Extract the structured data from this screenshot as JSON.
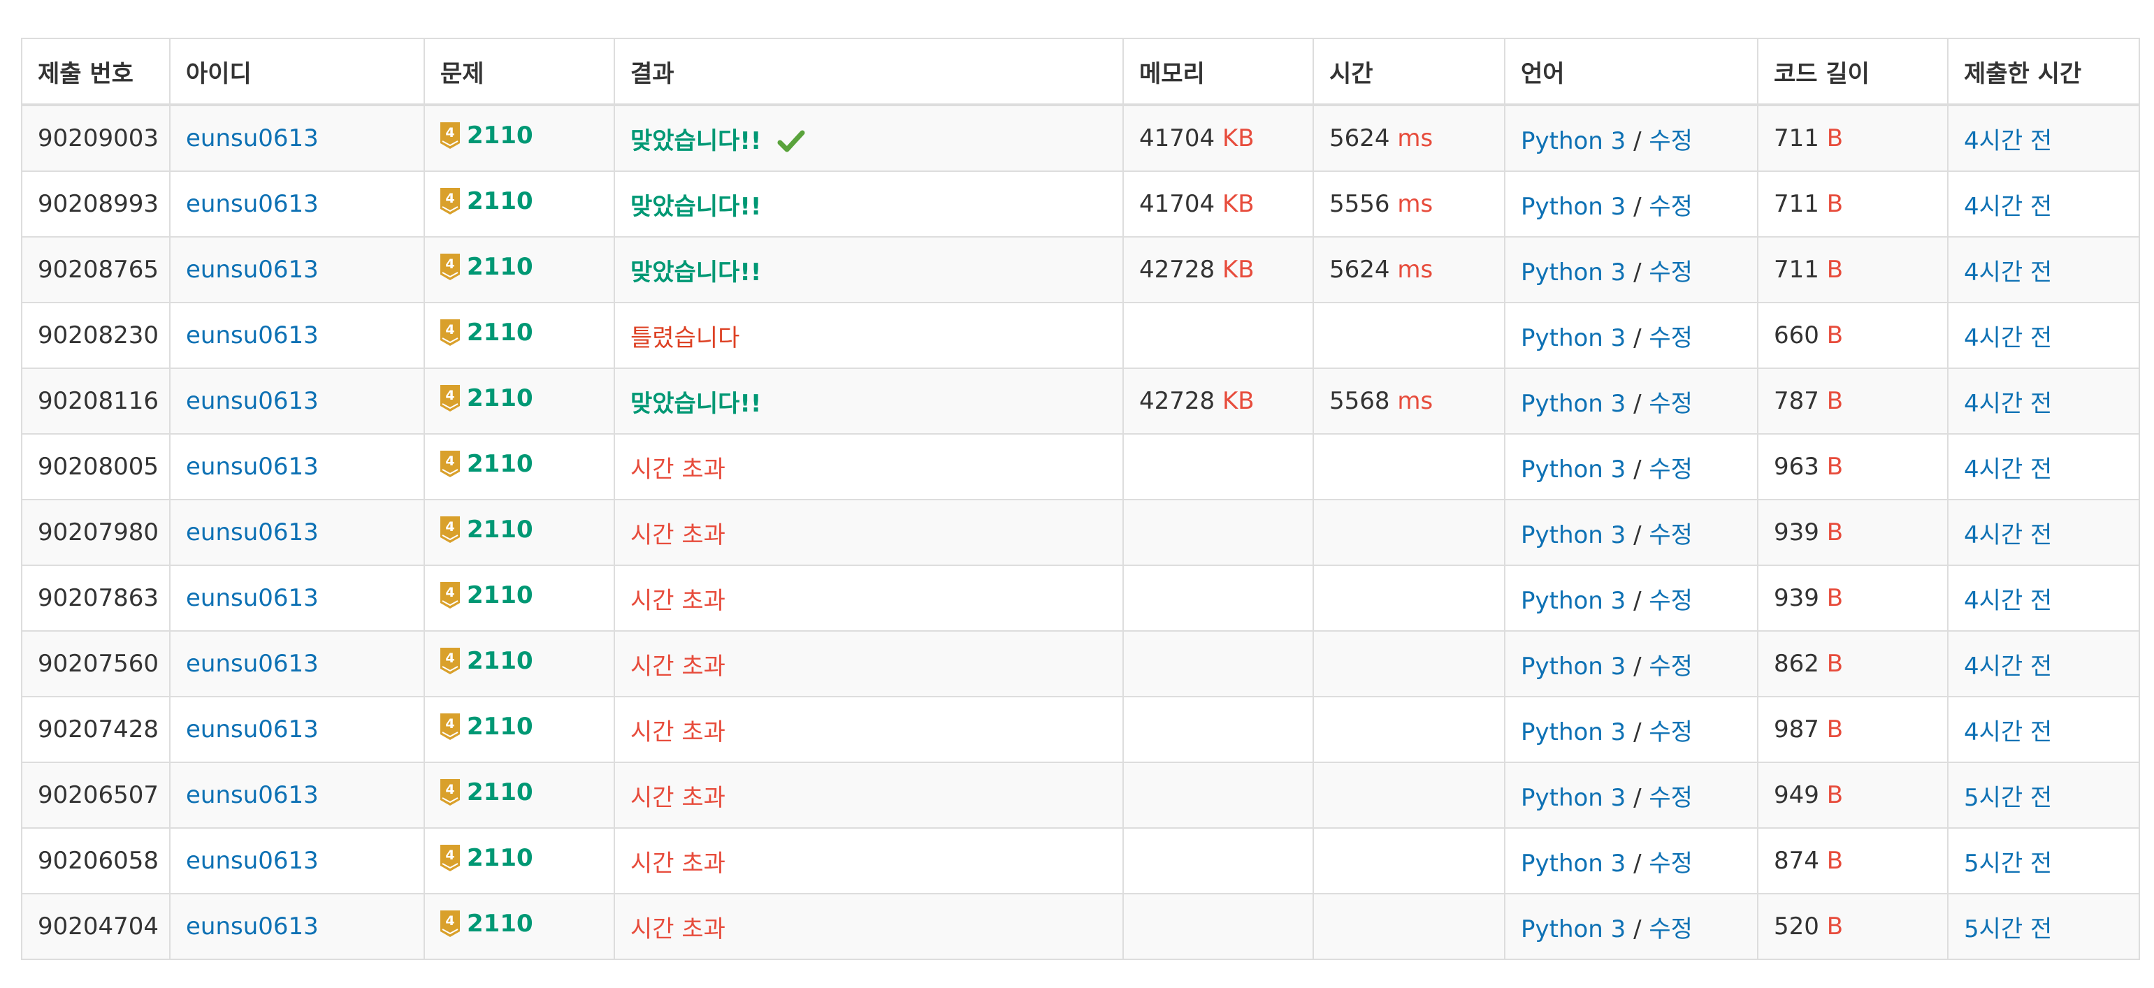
{
  "headers": [
    "제출 번호",
    "아이디",
    "문제",
    "결과",
    "메모리",
    "시간",
    "언어",
    "코드 길이",
    "제출한 시간"
  ],
  "units": {
    "memory": "KB",
    "time": "ms",
    "code": "B",
    "lang_sep": "/"
  },
  "colors": {
    "link": "#0e71b4",
    "unit": "#e74c3c",
    "accepted": "#009874",
    "wrong": "#dd4124",
    "timeout": "#e74c3c",
    "tier_gold": "#d9a02b",
    "check": "#5aa33c"
  },
  "icons": {
    "tier": "gold-tier-4-badge-icon",
    "accepted_check": "checkmark-icon"
  },
  "rows": [
    {
      "id": "90209003",
      "user": "eunsu0613",
      "tier": "4",
      "problem": "2110",
      "result": "맞았습니다!!",
      "status": "ac",
      "check": true,
      "memory": "41704",
      "time": "5624",
      "lang": "Python 3",
      "edit": "수정",
      "code": "711",
      "submitted": "4시간 전"
    },
    {
      "id": "90208993",
      "user": "eunsu0613",
      "tier": "4",
      "problem": "2110",
      "result": "맞았습니다!!",
      "status": "ac",
      "check": false,
      "memory": "41704",
      "time": "5556",
      "lang": "Python 3",
      "edit": "수정",
      "code": "711",
      "submitted": "4시간 전"
    },
    {
      "id": "90208765",
      "user": "eunsu0613",
      "tier": "4",
      "problem": "2110",
      "result": "맞았습니다!!",
      "status": "ac",
      "check": false,
      "memory": "42728",
      "time": "5624",
      "lang": "Python 3",
      "edit": "수정",
      "code": "711",
      "submitted": "4시간 전"
    },
    {
      "id": "90208230",
      "user": "eunsu0613",
      "tier": "4",
      "problem": "2110",
      "result": "틀렸습니다",
      "status": "wa",
      "check": false,
      "memory": "",
      "time": "",
      "lang": "Python 3",
      "edit": "수정",
      "code": "660",
      "submitted": "4시간 전"
    },
    {
      "id": "90208116",
      "user": "eunsu0613",
      "tier": "4",
      "problem": "2110",
      "result": "맞았습니다!!",
      "status": "ac",
      "check": false,
      "memory": "42728",
      "time": "5568",
      "lang": "Python 3",
      "edit": "수정",
      "code": "787",
      "submitted": "4시간 전"
    },
    {
      "id": "90208005",
      "user": "eunsu0613",
      "tier": "4",
      "problem": "2110",
      "result": "시간 초과",
      "status": "tle",
      "check": false,
      "memory": "",
      "time": "",
      "lang": "Python 3",
      "edit": "수정",
      "code": "963",
      "submitted": "4시간 전"
    },
    {
      "id": "90207980",
      "user": "eunsu0613",
      "tier": "4",
      "problem": "2110",
      "result": "시간 초과",
      "status": "tle",
      "check": false,
      "memory": "",
      "time": "",
      "lang": "Python 3",
      "edit": "수정",
      "code": "939",
      "submitted": "4시간 전"
    },
    {
      "id": "90207863",
      "user": "eunsu0613",
      "tier": "4",
      "problem": "2110",
      "result": "시간 초과",
      "status": "tle",
      "check": false,
      "memory": "",
      "time": "",
      "lang": "Python 3",
      "edit": "수정",
      "code": "939",
      "submitted": "4시간 전"
    },
    {
      "id": "90207560",
      "user": "eunsu0613",
      "tier": "4",
      "problem": "2110",
      "result": "시간 초과",
      "status": "tle",
      "check": false,
      "memory": "",
      "time": "",
      "lang": "Python 3",
      "edit": "수정",
      "code": "862",
      "submitted": "4시간 전"
    },
    {
      "id": "90207428",
      "user": "eunsu0613",
      "tier": "4",
      "problem": "2110",
      "result": "시간 초과",
      "status": "tle",
      "check": false,
      "memory": "",
      "time": "",
      "lang": "Python 3",
      "edit": "수정",
      "code": "987",
      "submitted": "4시간 전"
    },
    {
      "id": "90206507",
      "user": "eunsu0613",
      "tier": "4",
      "problem": "2110",
      "result": "시간 초과",
      "status": "tle",
      "check": false,
      "memory": "",
      "time": "",
      "lang": "Python 3",
      "edit": "수정",
      "code": "949",
      "submitted": "5시간 전"
    },
    {
      "id": "90206058",
      "user": "eunsu0613",
      "tier": "4",
      "problem": "2110",
      "result": "시간 초과",
      "status": "tle",
      "check": false,
      "memory": "",
      "time": "",
      "lang": "Python 3",
      "edit": "수정",
      "code": "874",
      "submitted": "5시간 전"
    },
    {
      "id": "90204704",
      "user": "eunsu0613",
      "tier": "4",
      "problem": "2110",
      "result": "시간 초과",
      "status": "tle",
      "check": false,
      "memory": "",
      "time": "",
      "lang": "Python 3",
      "edit": "수정",
      "code": "520",
      "submitted": "5시간 전"
    }
  ]
}
